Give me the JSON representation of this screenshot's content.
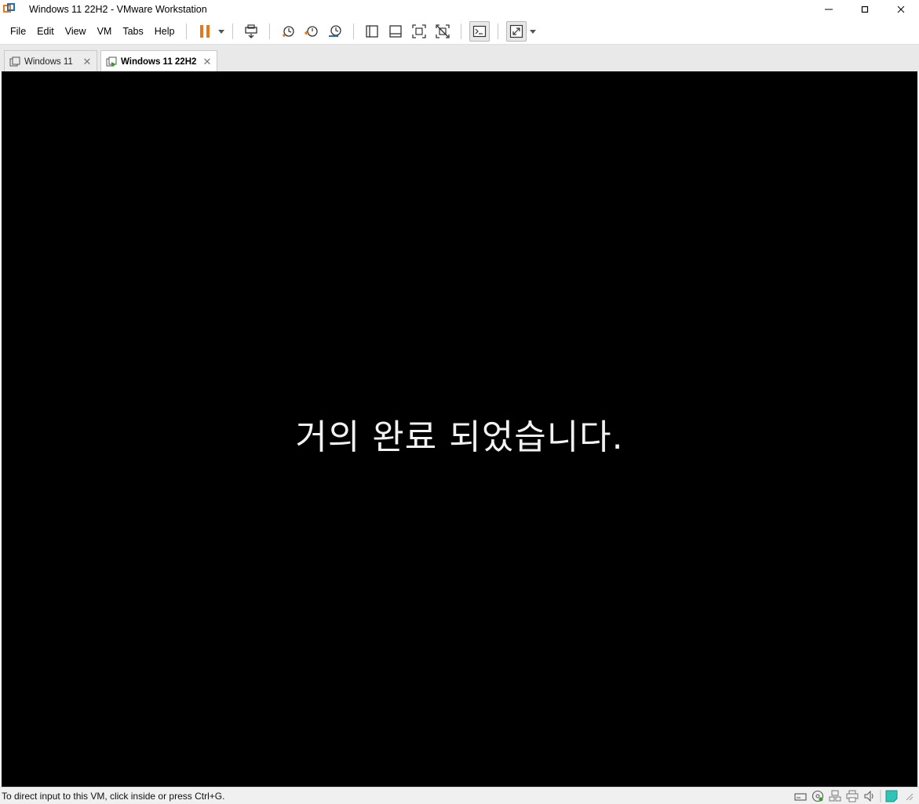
{
  "window": {
    "title": "Windows 11 22H2 - VMware Workstation"
  },
  "menu": {
    "items": [
      "File",
      "Edit",
      "View",
      "VM",
      "Tabs",
      "Help"
    ]
  },
  "toolbar": {
    "icons": [
      "pause-icon",
      "send-ctrl-alt-del-icon",
      "snapshot-icon",
      "revert-snapshot-icon",
      "snapshot-manager-icon",
      "library-view-icon",
      "thumbnail-view-icon",
      "fit-guest-icon",
      "no-fit-icon",
      "console-view-icon",
      "full-screen-icon"
    ],
    "accent": "#e8761b"
  },
  "tabs": [
    {
      "label": "Windows 11",
      "active": false
    },
    {
      "label": "Windows 11 22H2",
      "active": true
    }
  ],
  "vm": {
    "message": "거의 완료 되었습니다."
  },
  "status": {
    "text": "To direct input to this VM, click inside or press Ctrl+G.",
    "icons": [
      "hard-disk-icon",
      "cd-dvd-icon",
      "network-icon",
      "printer-icon",
      "sound-icon",
      "message-icon"
    ]
  }
}
